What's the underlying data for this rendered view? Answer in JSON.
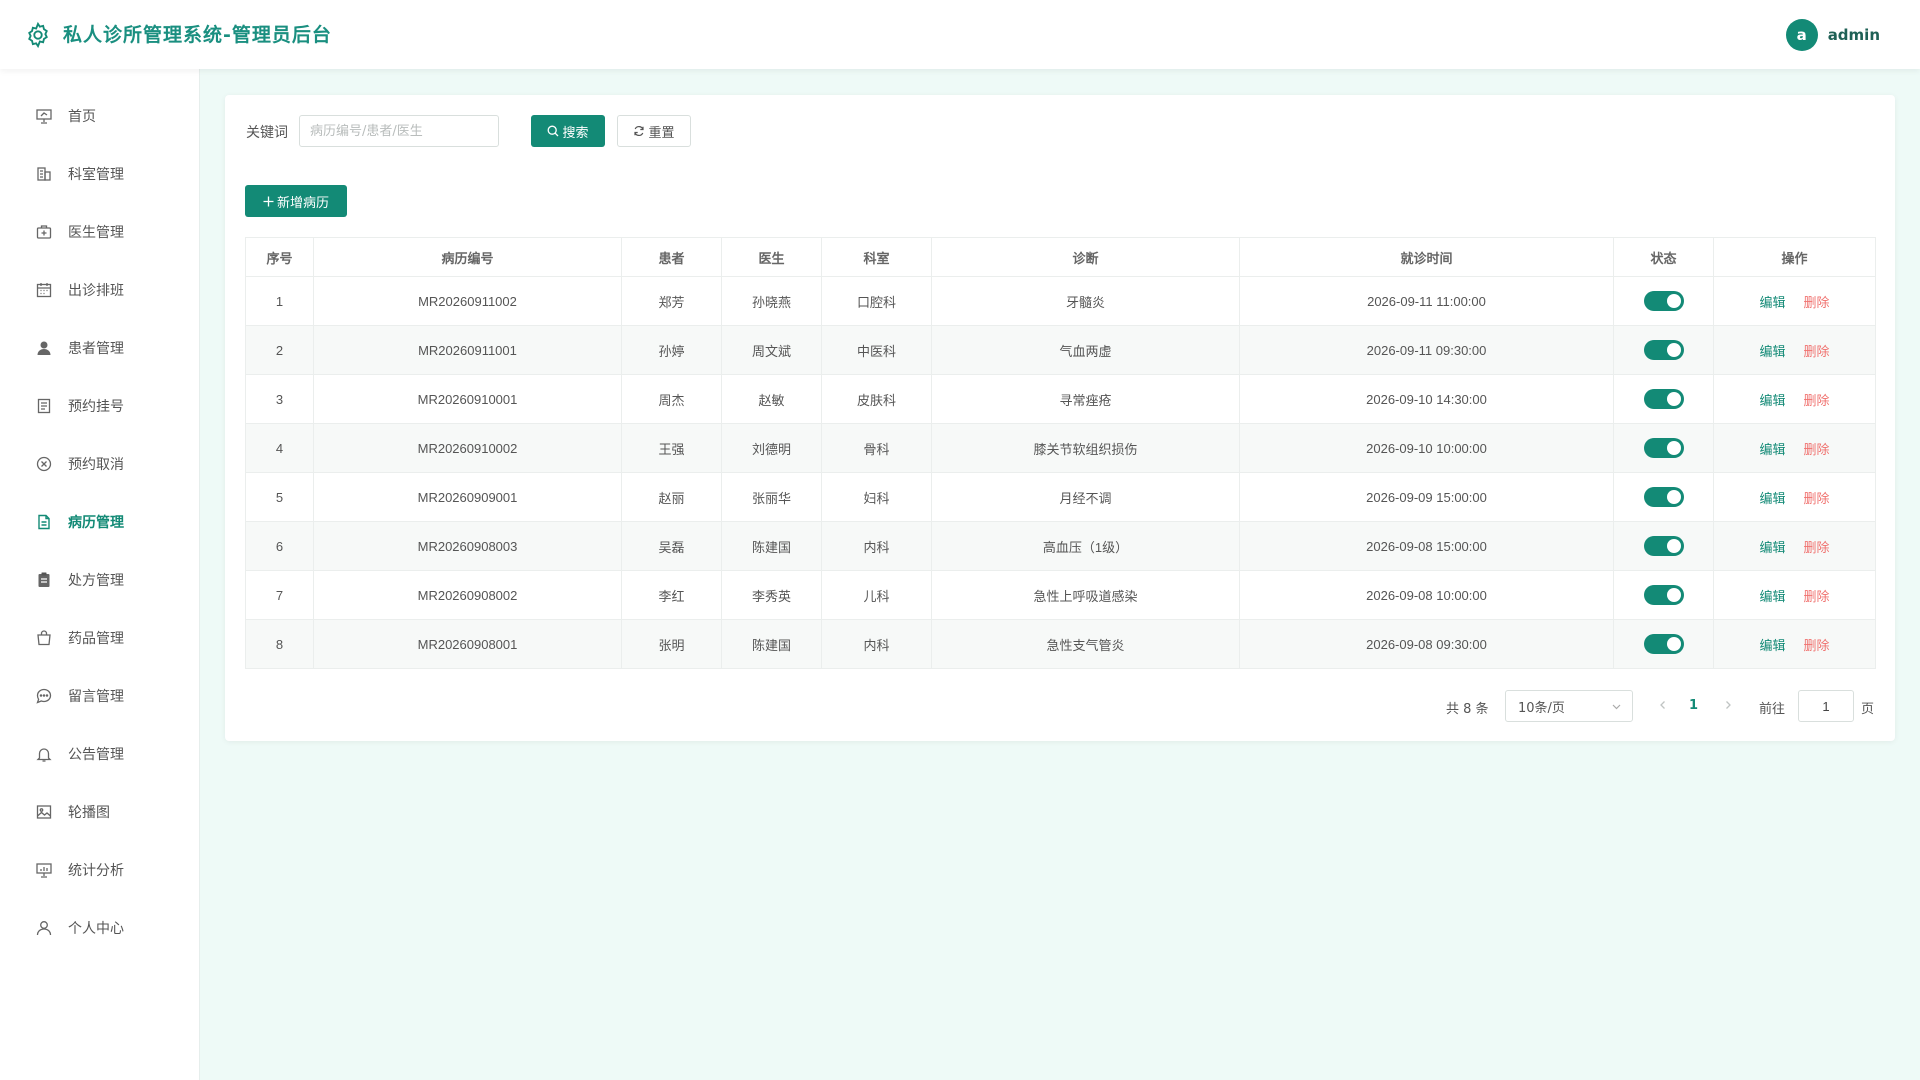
{
  "header": {
    "title": "私人诊所管理系统-管理员后台",
    "avatar_letter": "a",
    "username": "admin"
  },
  "sidebar": {
    "items": [
      {
        "label": "首页",
        "icon": "presentation-icon"
      },
      {
        "label": "科室管理",
        "icon": "building-icon"
      },
      {
        "label": "医生管理",
        "icon": "medical-box-icon"
      },
      {
        "label": "出诊排班",
        "icon": "calendar-icon"
      },
      {
        "label": "患者管理",
        "icon": "user-filled-icon"
      },
      {
        "label": "预约挂号",
        "icon": "document-icon"
      },
      {
        "label": "预约取消",
        "icon": "circle-close-icon"
      },
      {
        "label": "病历管理",
        "icon": "document-text-icon",
        "active": true
      },
      {
        "label": "处方管理",
        "icon": "clipboard-icon"
      },
      {
        "label": "药品管理",
        "icon": "shopping-bag-icon"
      },
      {
        "label": "留言管理",
        "icon": "chat-icon"
      },
      {
        "label": "公告管理",
        "icon": "bell-icon"
      },
      {
        "label": "轮播图",
        "icon": "picture-icon"
      },
      {
        "label": "统计分析",
        "icon": "chart-board-icon"
      },
      {
        "label": "个人中心",
        "icon": "user-icon"
      }
    ]
  },
  "search": {
    "keyword_label": "关键词",
    "placeholder": "病历编号/患者/医生",
    "value": "",
    "search_label": "搜索",
    "reset_label": "重置"
  },
  "toolbar": {
    "add_label": "新增病历"
  },
  "table": {
    "columns": [
      "序号",
      "病历编号",
      "患者",
      "医生",
      "科室",
      "诊断",
      "就诊时间",
      "状态",
      "操作"
    ],
    "edit_label": "编辑",
    "delete_label": "删除",
    "rows": [
      {
        "index": "1",
        "record_no": "MR20260911002",
        "patient": "郑芳",
        "doctor": "孙晓燕",
        "dept": "口腔科",
        "diagnosis": "牙髓炎",
        "time": "2026-09-11 11:00:00",
        "enabled": true
      },
      {
        "index": "2",
        "record_no": "MR20260911001",
        "patient": "孙婷",
        "doctor": "周文斌",
        "dept": "中医科",
        "diagnosis": "气血两虚",
        "time": "2026-09-11 09:30:00",
        "enabled": true
      },
      {
        "index": "3",
        "record_no": "MR20260910001",
        "patient": "周杰",
        "doctor": "赵敏",
        "dept": "皮肤科",
        "diagnosis": "寻常痤疮",
        "time": "2026-09-10 14:30:00",
        "enabled": true
      },
      {
        "index": "4",
        "record_no": "MR20260910002",
        "patient": "王强",
        "doctor": "刘德明",
        "dept": "骨科",
        "diagnosis": "膝关节软组织损伤",
        "time": "2026-09-10 10:00:00",
        "enabled": true
      },
      {
        "index": "5",
        "record_no": "MR20260909001",
        "patient": "赵丽",
        "doctor": "张丽华",
        "dept": "妇科",
        "diagnosis": "月经不调",
        "time": "2026-09-09 15:00:00",
        "enabled": true
      },
      {
        "index": "6",
        "record_no": "MR20260908003",
        "patient": "吴磊",
        "doctor": "陈建国",
        "dept": "内科",
        "diagnosis": "高血压（1级）",
        "time": "2026-09-08 15:00:00",
        "enabled": true
      },
      {
        "index": "7",
        "record_no": "MR20260908002",
        "patient": "李红",
        "doctor": "李秀英",
        "dept": "儿科",
        "diagnosis": "急性上呼吸道感染",
        "time": "2026-09-08 10:00:00",
        "enabled": true
      },
      {
        "index": "8",
        "record_no": "MR20260908001",
        "patient": "张明",
        "doctor": "陈建国",
        "dept": "内科",
        "diagnosis": "急性支气管炎",
        "time": "2026-09-08 09:30:00",
        "enabled": true
      }
    ]
  },
  "pagination": {
    "total_text": "共 8 条",
    "page_size": "10条/页",
    "current_page": "1",
    "goto_label": "前往",
    "goto_value": "1",
    "unit_label": "页"
  },
  "colors": {
    "primary": "#138a76",
    "danger": "#f0716e",
    "background": "#eefaf7"
  }
}
